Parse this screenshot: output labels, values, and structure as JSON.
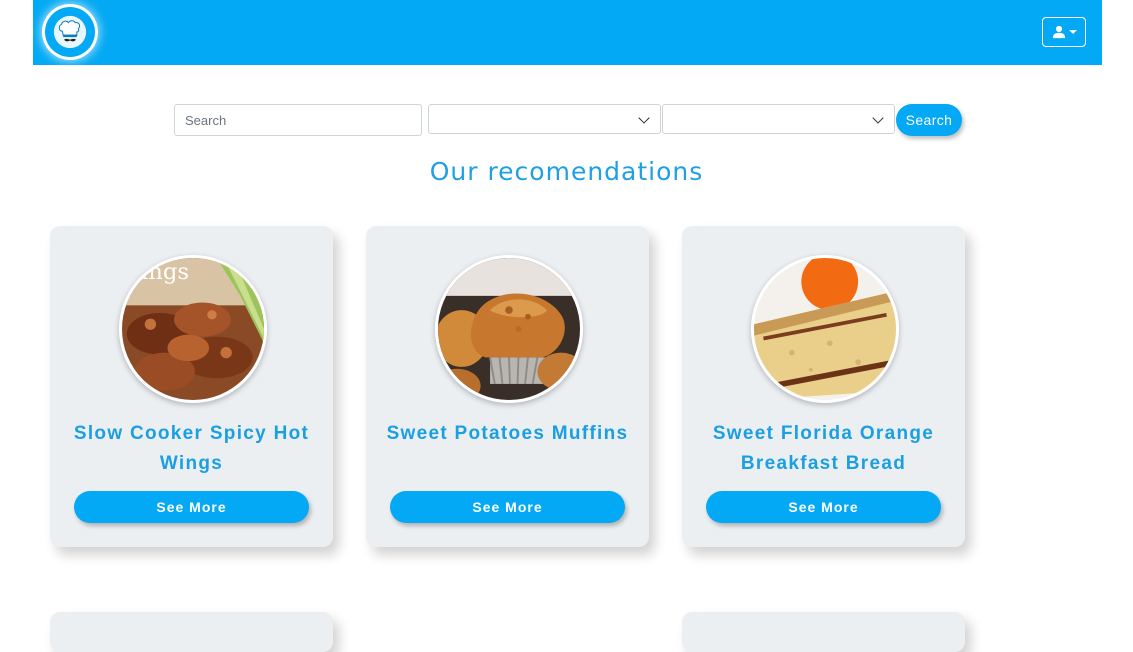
{
  "header": {
    "logo_icon": "chef-hat-icon",
    "user_menu_icon": "user-icon"
  },
  "search": {
    "placeholder": "Search",
    "value": "",
    "filter_1_value": "",
    "filter_2_value": "",
    "button_label": "Search"
  },
  "section": {
    "title": "Our recomendations"
  },
  "recipes": [
    {
      "title": "Slow Cooker Spicy Hot Wings",
      "button_label": "See More",
      "image_text": "ings"
    },
    {
      "title": "Sweet Potatoes Muffins",
      "button_label": "See More"
    },
    {
      "title": "Sweet Florida Orange Breakfast Bread",
      "button_label": "See More"
    }
  ],
  "colors": {
    "primary": "#03a9f4",
    "title_blue": "#1fa0e4",
    "card_bg": "#eceff2"
  }
}
